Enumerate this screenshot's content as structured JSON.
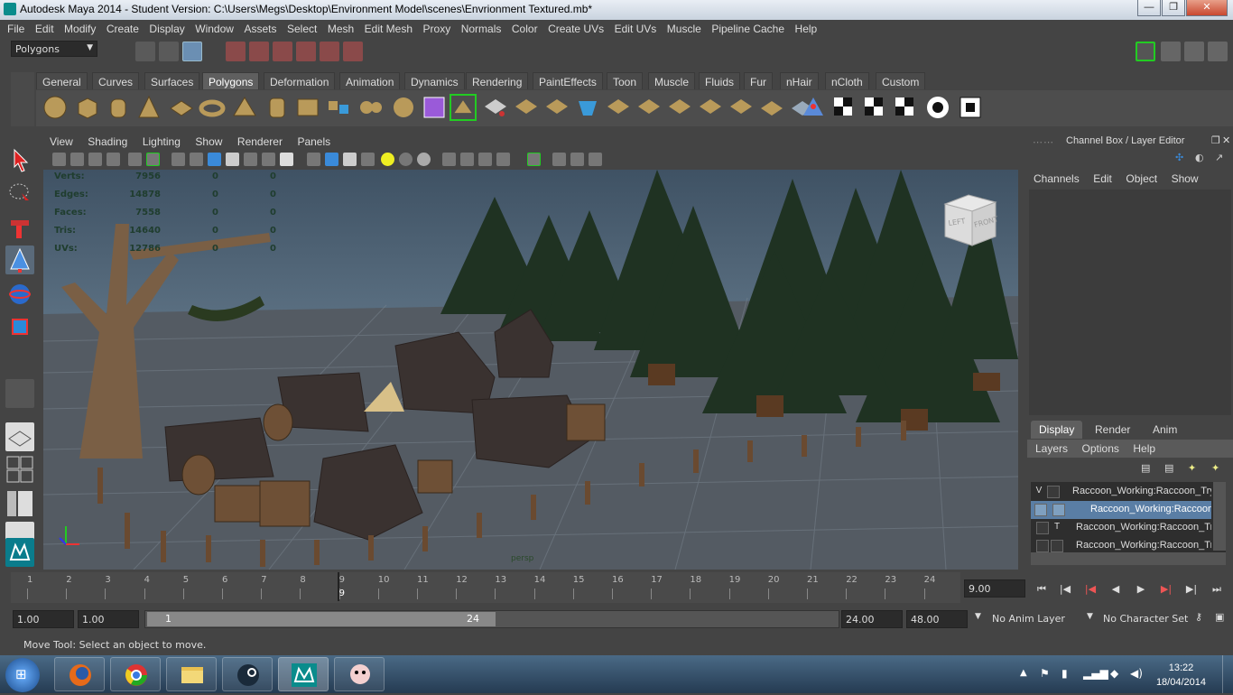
{
  "window": {
    "title": "Autodesk Maya 2014 - Student Version: C:\\Users\\Megs\\Desktop\\Environment Model\\scenes\\Envrionment Textured.mb*",
    "minimize": "—",
    "maximize": "❐",
    "close": "✕"
  },
  "menubar": [
    "File",
    "Edit",
    "Modify",
    "Create",
    "Display",
    "Window",
    "Assets",
    "Select",
    "Mesh",
    "Edit Mesh",
    "Proxy",
    "Normals",
    "Color",
    "Create UVs",
    "Edit UVs",
    "Muscle",
    "Pipeline Cache",
    "Help"
  ],
  "statusline": {
    "menu_set": "Polygons"
  },
  "shelf": {
    "tabs": [
      "General",
      "Curves",
      "Surfaces",
      "Polygons",
      "Deformation",
      "Animation",
      "Dynamics",
      "Rendering",
      "PaintEffects",
      "Toon",
      "Muscle",
      "Fluids",
      "Fur",
      "nHair",
      "nCloth",
      "Custom"
    ],
    "active_tab": "Polygons"
  },
  "panel_menu": [
    "View",
    "Shading",
    "Lighting",
    "Show",
    "Renderer",
    "Panels"
  ],
  "hud": {
    "rows": [
      {
        "label": "Verts:",
        "a": "7956",
        "b": "0",
        "c": "0"
      },
      {
        "label": "Edges:",
        "a": "14878",
        "b": "0",
        "c": "0"
      },
      {
        "label": "Faces:",
        "a": "7558",
        "b": "0",
        "c": "0"
      },
      {
        "label": "Tris:",
        "a": "14640",
        "b": "0",
        "c": "0"
      },
      {
        "label": "UVs:",
        "a": "12786",
        "b": "0",
        "c": "0"
      }
    ],
    "camera": "persp"
  },
  "viewcube": {
    "left": "LEFT",
    "front": "FRONT"
  },
  "channel_box": {
    "title": "Channel Box / Layer Editor",
    "menu": [
      "Channels",
      "Edit",
      "Object",
      "Show"
    ]
  },
  "layer_editor": {
    "tabs": [
      "Display",
      "Render",
      "Anim"
    ],
    "active_tab": "Display",
    "menu": [
      "Layers",
      "Options",
      "Help"
    ],
    "layers": [
      {
        "v": "V",
        "p": "",
        "name": "Raccoon_Working:Raccoon_Try"
      },
      {
        "v": "",
        "p": "",
        "name": "Raccoon_Working:Raccoon"
      },
      {
        "v": "",
        "p": "T",
        "name": "Raccoon_Working:Raccoon_Tr"
      },
      {
        "v": "",
        "p": "",
        "name": "Raccoon_Working:Raccoon_Try"
      }
    ]
  },
  "timeline": {
    "ticks": [
      "1",
      "2",
      "3",
      "4",
      "5",
      "6",
      "7",
      "8",
      "9",
      "10",
      "11",
      "12",
      "13",
      "14",
      "15",
      "16",
      "17",
      "18",
      "19",
      "20",
      "21",
      "22",
      "23",
      "24"
    ],
    "current_frame": "9",
    "current_time_field": "9.00"
  },
  "range": {
    "start_time": "1.00",
    "playback_start": "1.00",
    "range_start_label": "1",
    "range_end_label": "24",
    "playback_end": "24.00",
    "end_time": "48.00",
    "anim_layer": "No Anim Layer",
    "character_set": "No Character Set"
  },
  "helpline": "Move Tool: Select an object to move.",
  "taskbar": {
    "time": "13:22",
    "date": "18/04/2014"
  },
  "colors": {
    "maya_bg": "#444444",
    "accent_blue": "#5a7ea5",
    "hud_text": "#1f3d2e"
  }
}
